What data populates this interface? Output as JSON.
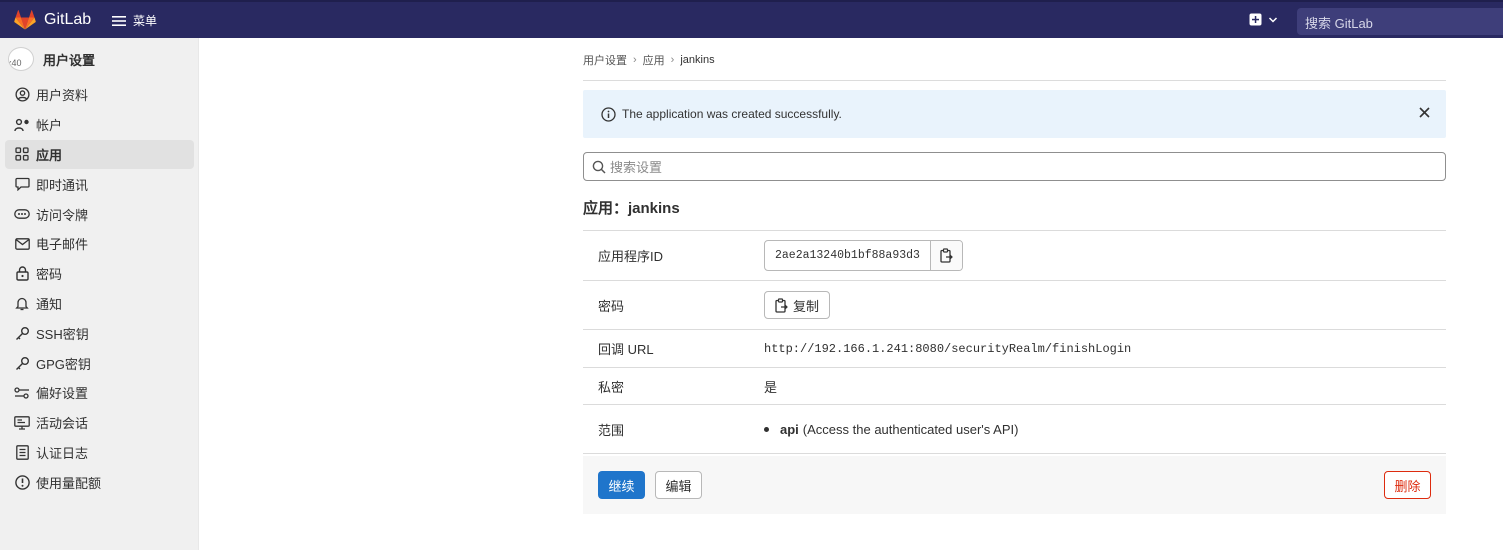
{
  "colors": {
    "topbar": "#292961",
    "primary": "#1f75cb",
    "danger": "#dd2b0e",
    "alert_bg": "#e9f3fc"
  },
  "topbar": {
    "brand": "GitLab",
    "menu_label": "菜单",
    "search_placeholder": "搜索 GitLab",
    "icons": {
      "logo": "gitlab-tanuki-icon",
      "menu": "hamburger-icon",
      "new": "plus-square-icon",
      "caret": "chevron-down-icon"
    }
  },
  "sidebar": {
    "avatar_text": "x40",
    "title": "用户设置",
    "items": [
      {
        "label": "用户资料",
        "icon": "user-circle-icon"
      },
      {
        "label": "帐户",
        "icon": "account-gear-icon"
      },
      {
        "label": "应用",
        "icon": "applications-grid-icon",
        "active": true
      },
      {
        "label": "即时通讯",
        "icon": "comment-icon"
      },
      {
        "label": "访问令牌",
        "icon": "token-icon"
      },
      {
        "label": "电子邮件",
        "icon": "mail-icon"
      },
      {
        "label": "密码",
        "icon": "lock-icon"
      },
      {
        "label": "通知",
        "icon": "bell-icon"
      },
      {
        "label": "SSH密钥",
        "icon": "key-icon"
      },
      {
        "label": "GPG密钥",
        "icon": "key-icon"
      },
      {
        "label": "偏好设置",
        "icon": "preferences-icon"
      },
      {
        "label": "活动会话",
        "icon": "monitor-icon"
      },
      {
        "label": "认证日志",
        "icon": "log-icon"
      },
      {
        "label": "使用量配额",
        "icon": "quota-icon"
      }
    ]
  },
  "breadcrumb": {
    "items": [
      "用户设置",
      "应用",
      "jankins"
    ]
  },
  "alert": {
    "message": "The application was created successfully."
  },
  "settings_search": {
    "placeholder": "搜索设置"
  },
  "app": {
    "title": "应用：jankins",
    "rows": {
      "app_id_label": "应用程序ID",
      "app_id_value": "2ae2a13240b1bf88a93d3",
      "secret_label": "密码",
      "copy_label": "复制",
      "callback_label": "回调 URL",
      "callback_value": "http://192.166.1.241:8080/securityRealm/finishLogin",
      "confidential_label": "私密",
      "confidential_value": "是",
      "scopes_label": "范围",
      "scope_name": "api",
      "scope_desc": "(Access the authenticated user's API)"
    }
  },
  "actions": {
    "continue": "继续",
    "edit": "编辑",
    "delete": "删除"
  }
}
